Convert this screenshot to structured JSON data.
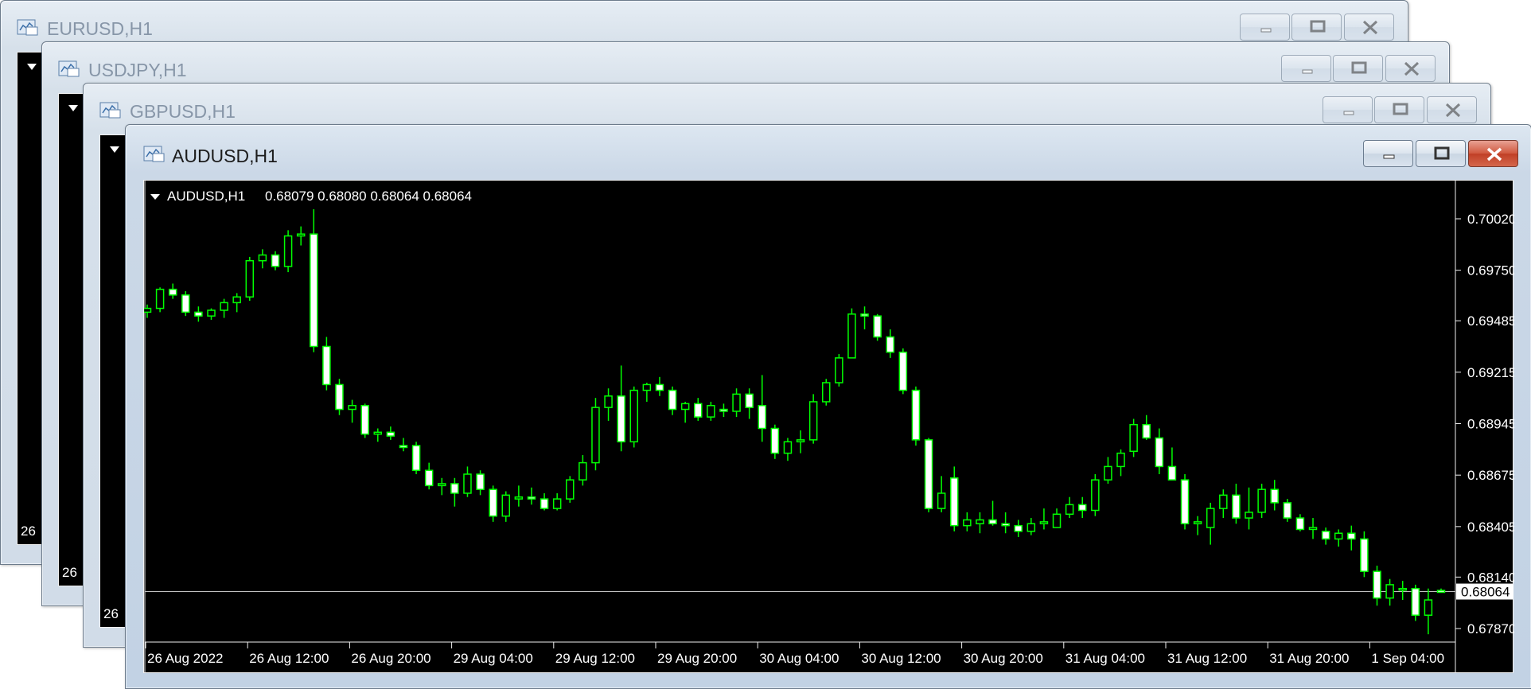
{
  "windows": [
    {
      "id": "eurusd",
      "title": "EURUSD,H1",
      "active": false,
      "date_label": "26"
    },
    {
      "id": "usdjpy",
      "title": "USDJPY,H1",
      "active": false,
      "date_label": "26"
    },
    {
      "id": "gbpusd",
      "title": "GBPUSD,H1",
      "active": false,
      "date_label": "26"
    },
    {
      "id": "audusd",
      "title": "AUDUSD,H1",
      "active": true
    }
  ],
  "chart_header": {
    "symbol": "AUDUSD,H1",
    "ohlc": "0.68079 0.68080 0.68064 0.68064"
  },
  "colors": {
    "background": "#000000",
    "bull_candle": "#ffffff",
    "bear_candle": "#ffffff",
    "wick": "#00ff00",
    "grid_line": "#c0c0c0",
    "close_button": "#c8452c"
  },
  "chart_data": {
    "type": "candlestick",
    "symbol": "AUDUSD",
    "timeframe": "H1",
    "current_price": "0.68064",
    "y_ticks": [
      "0.70020",
      "0.69750",
      "0.69485",
      "0.69215",
      "0.68945",
      "0.68675",
      "0.68405",
      "0.68140",
      "0.67870"
    ],
    "ylim": [
      0.6787,
      0.7002
    ],
    "x_ticks": [
      "26 Aug 2022",
      "26 Aug 12:00",
      "26 Aug 20:00",
      "29 Aug 04:00",
      "29 Aug 12:00",
      "29 Aug 20:00",
      "30 Aug 04:00",
      "30 Aug 12:00",
      "30 Aug 20:00",
      "31 Aug 04:00",
      "31 Aug 12:00",
      "31 Aug 20:00",
      "1 Sep 04:00"
    ],
    "candles": [
      [
        0.6953,
        0.6957,
        0.695,
        0.6955
      ],
      [
        0.6955,
        0.6966,
        0.6953,
        0.6965
      ],
      [
        0.6965,
        0.6968,
        0.696,
        0.6962
      ],
      [
        0.6962,
        0.6964,
        0.6951,
        0.6953
      ],
      [
        0.6953,
        0.6956,
        0.6948,
        0.6951
      ],
      [
        0.6951,
        0.6955,
        0.6949,
        0.6954
      ],
      [
        0.6954,
        0.696,
        0.695,
        0.6958
      ],
      [
        0.6958,
        0.6963,
        0.6953,
        0.6961
      ],
      [
        0.6961,
        0.6982,
        0.6959,
        0.698
      ],
      [
        0.698,
        0.6986,
        0.6976,
        0.6983
      ],
      [
        0.6983,
        0.6985,
        0.6975,
        0.6977
      ],
      [
        0.6977,
        0.6996,
        0.6974,
        0.6993
      ],
      [
        0.6993,
        0.6998,
        0.6988,
        0.6994
      ],
      [
        0.6994,
        0.7007,
        0.6932,
        0.6935
      ],
      [
        0.6935,
        0.694,
        0.6912,
        0.6915
      ],
      [
        0.6915,
        0.6918,
        0.6899,
        0.6902
      ],
      [
        0.6902,
        0.6907,
        0.6895,
        0.6904
      ],
      [
        0.6904,
        0.6905,
        0.6887,
        0.6889
      ],
      [
        0.6889,
        0.6892,
        0.6885,
        0.689
      ],
      [
        0.689,
        0.6893,
        0.6886,
        0.6888
      ],
      [
        0.6883,
        0.6887,
        0.688,
        0.6882
      ],
      [
        0.6883,
        0.6885,
        0.6868,
        0.687
      ],
      [
        0.687,
        0.6874,
        0.686,
        0.6862
      ],
      [
        0.6862,
        0.6866,
        0.6857,
        0.6863
      ],
      [
        0.6863,
        0.6866,
        0.6851,
        0.6858
      ],
      [
        0.6858,
        0.6872,
        0.6856,
        0.6868
      ],
      [
        0.6868,
        0.687,
        0.6857,
        0.686
      ],
      [
        0.686,
        0.6862,
        0.6843,
        0.6846
      ],
      [
        0.6846,
        0.6859,
        0.6843,
        0.6857
      ],
      [
        0.6855,
        0.6862,
        0.6851,
        0.6856
      ],
      [
        0.6856,
        0.6861,
        0.6852,
        0.6855
      ],
      [
        0.6855,
        0.6858,
        0.6849,
        0.685
      ],
      [
        0.685,
        0.6858,
        0.6849,
        0.6855
      ],
      [
        0.6855,
        0.6867,
        0.6853,
        0.6865
      ],
      [
        0.6865,
        0.6878,
        0.6862,
        0.6874
      ],
      [
        0.6874,
        0.6908,
        0.687,
        0.6903
      ],
      [
        0.6903,
        0.6913,
        0.6896,
        0.6909
      ],
      [
        0.6909,
        0.6925,
        0.688,
        0.6885
      ],
      [
        0.6885,
        0.6914,
        0.6882,
        0.6912
      ],
      [
        0.6912,
        0.6916,
        0.6906,
        0.6915
      ],
      [
        0.6915,
        0.6919,
        0.6909,
        0.6912
      ],
      [
        0.6912,
        0.6914,
        0.6899,
        0.6902
      ],
      [
        0.6902,
        0.6906,
        0.6895,
        0.6905
      ],
      [
        0.6905,
        0.6908,
        0.6896,
        0.6898
      ],
      [
        0.6898,
        0.6906,
        0.6896,
        0.6904
      ],
      [
        0.6902,
        0.6905,
        0.6898,
        0.6901
      ],
      [
        0.6901,
        0.6913,
        0.6898,
        0.691
      ],
      [
        0.691,
        0.6913,
        0.6897,
        0.6903
      ],
      [
        0.6904,
        0.692,
        0.6885,
        0.6892
      ],
      [
        0.6892,
        0.6894,
        0.6876,
        0.6879
      ],
      [
        0.6879,
        0.6887,
        0.6875,
        0.6885
      ],
      [
        0.6885,
        0.6891,
        0.6879,
        0.6886
      ],
      [
        0.6886,
        0.691,
        0.6884,
        0.6906
      ],
      [
        0.6906,
        0.6918,
        0.6904,
        0.6916
      ],
      [
        0.6916,
        0.6931,
        0.6914,
        0.6929
      ],
      [
        0.6929,
        0.6955,
        0.6929,
        0.6952
      ],
      [
        0.6952,
        0.6956,
        0.6944,
        0.6951
      ],
      [
        0.6951,
        0.6952,
        0.6938,
        0.694
      ],
      [
        0.694,
        0.6944,
        0.6929,
        0.6932
      ],
      [
        0.6932,
        0.6934,
        0.691,
        0.6912
      ],
      [
        0.6912,
        0.6914,
        0.6883,
        0.6886
      ],
      [
        0.6886,
        0.6887,
        0.6848,
        0.685
      ],
      [
        0.685,
        0.6867,
        0.6848,
        0.6858
      ],
      [
        0.6866,
        0.6872,
        0.6838,
        0.6841
      ],
      [
        0.6841,
        0.6848,
        0.6838,
        0.6844
      ],
      [
        0.6842,
        0.6848,
        0.6837,
        0.6844
      ],
      [
        0.6844,
        0.6854,
        0.6841,
        0.6842
      ],
      [
        0.6842,
        0.6848,
        0.6837,
        0.6841
      ],
      [
        0.6841,
        0.6844,
        0.6835,
        0.6838
      ],
      [
        0.6838,
        0.6845,
        0.6836,
        0.6842
      ],
      [
        0.6842,
        0.685,
        0.6839,
        0.6843
      ],
      [
        0.684,
        0.685,
        0.684,
        0.6847
      ],
      [
        0.6847,
        0.6856,
        0.6845,
        0.6852
      ],
      [
        0.6852,
        0.6856,
        0.6845,
        0.6849
      ],
      [
        0.6849,
        0.6868,
        0.6846,
        0.6865
      ],
      [
        0.6865,
        0.6877,
        0.6863,
        0.6872
      ],
      [
        0.6872,
        0.6881,
        0.6867,
        0.6879
      ],
      [
        0.688,
        0.6897,
        0.6877,
        0.6894
      ],
      [
        0.6894,
        0.6899,
        0.6886,
        0.6887
      ],
      [
        0.6887,
        0.6892,
        0.6868,
        0.6872
      ],
      [
        0.6872,
        0.6882,
        0.6866,
        0.6865
      ],
      [
        0.6865,
        0.6868,
        0.6839,
        0.6842
      ],
      [
        0.6842,
        0.6846,
        0.6836,
        0.6843
      ],
      [
        0.684,
        0.6853,
        0.6831,
        0.685
      ],
      [
        0.685,
        0.686,
        0.6845,
        0.6857
      ],
      [
        0.6857,
        0.6863,
        0.6842,
        0.6845
      ],
      [
        0.6845,
        0.6861,
        0.6839,
        0.6848
      ],
      [
        0.6848,
        0.6863,
        0.6845,
        0.686
      ],
      [
        0.686,
        0.6865,
        0.6849,
        0.6853
      ],
      [
        0.6853,
        0.6855,
        0.6843,
        0.6845
      ],
      [
        0.6845,
        0.6847,
        0.6838,
        0.6839
      ],
      [
        0.6839,
        0.6845,
        0.6834,
        0.684
      ],
      [
        0.6838,
        0.684,
        0.6831,
        0.6834
      ],
      [
        0.6834,
        0.6839,
        0.683,
        0.6837
      ],
      [
        0.6837,
        0.6841,
        0.6828,
        0.6834
      ],
      [
        0.6834,
        0.6838,
        0.6814,
        0.6817
      ],
      [
        0.6817,
        0.682,
        0.6799,
        0.6803
      ],
      [
        0.6803,
        0.6813,
        0.6799,
        0.681
      ],
      [
        0.6808,
        0.6812,
        0.6802,
        0.6808
      ],
      [
        0.6808,
        0.681,
        0.6791,
        0.6794
      ],
      [
        0.6794,
        0.6808,
        0.6784,
        0.6802
      ],
      [
        0.6807,
        0.6808,
        0.6806,
        0.6806
      ]
    ]
  }
}
